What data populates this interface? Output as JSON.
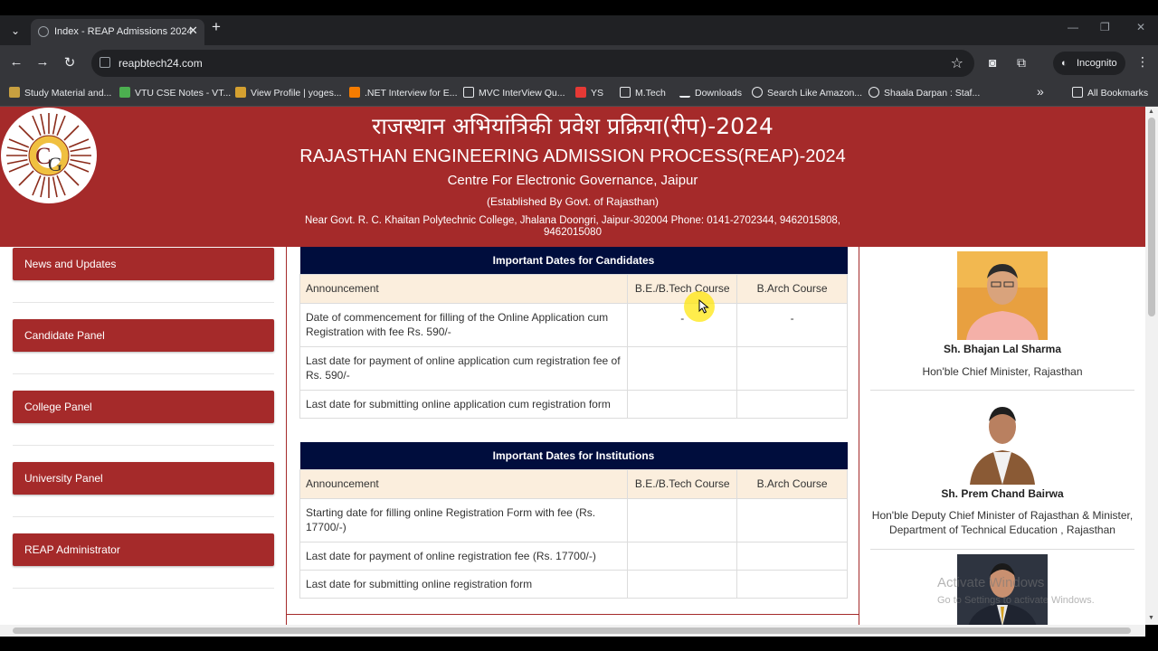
{
  "browser": {
    "tab_title": "Index - REAP Admissions 2024",
    "tab_close": "✕",
    "new_tab": "+",
    "url": "reapbtech24.com",
    "incognito_label": "Incognito",
    "bookmarks": [
      "Study Material and...",
      "VTU CSE Notes - VT...",
      "View Profile | yoges...",
      ".NET Interview for E...",
      "MVC InterView Qu...",
      "YS",
      "M.Tech",
      "Downloads",
      "Search Like Amazon...",
      "Shaala Darpan : Staf..."
    ],
    "all_bookmarks": "All Bookmarks",
    "more_bookmarks": "»"
  },
  "header": {
    "hindi_title": "राजस्थान अभियांत्रिकी प्रवेश प्रक्रिया(रीप)-2024",
    "english_title": "RAJASTHAN ENGINEERING ADMISSION PROCESS(REAP)-2024",
    "org": "Centre For Electronic Governance, Jaipur",
    "established": "(Established By Govt. of Rajasthan)",
    "address": "Near Govt. R. C. Khaitan Polytechnic College, Jhalana Doongri, Jaipur-302004 Phone: 0141-2702344, 9462015808, 9462015080"
  },
  "sidebar": {
    "items": [
      "News and Updates",
      "Candidate Panel",
      "College Panel",
      "University Panel",
      "REAP Administrator"
    ]
  },
  "candidates_table": {
    "caption": "Important Dates for Candidates",
    "headers": [
      "Announcement",
      "B.E./B.Tech Course",
      "B.Arch Course"
    ],
    "rows": [
      [
        "Date of commencement for filling of the Online Application cum Registration with fee Rs. 590/-",
        "-",
        "-"
      ],
      [
        "Last date for payment of online application cum registration fee of Rs. 590/-",
        "",
        ""
      ],
      [
        "Last date for submitting online application cum registration form",
        "",
        ""
      ]
    ]
  },
  "institutions_table": {
    "caption": "Important Dates for Institutions",
    "headers": [
      "Announcement",
      "B.E./B.Tech Course",
      "B.Arch Course"
    ],
    "rows": [
      [
        "Starting date for filling online Registration Form with fee (Rs. 17700/-)",
        "",
        ""
      ],
      [
        "Last date for payment of online registration fee (Rs. 17700/-)",
        "",
        ""
      ],
      [
        "Last date for submitting online registration form",
        "",
        ""
      ]
    ]
  },
  "officials": [
    {
      "name": "Sh. Bhajan Lal Sharma",
      "title": "Hon'ble Chief Minister, Rajasthan"
    },
    {
      "name": "Sh. Prem Chand Bairwa",
      "title": "Hon'ble Deputy Chief Minister of Rajasthan & Minister, Department of Technical Education , Rajasthan"
    }
  ],
  "watermark": {
    "line1": "Activate Windows",
    "line2": "Go to Settings to activate Windows."
  },
  "colors": {
    "brand_red": "#a52a2a",
    "table_caption": "#000d3d",
    "table_header": "#fbeedd"
  }
}
